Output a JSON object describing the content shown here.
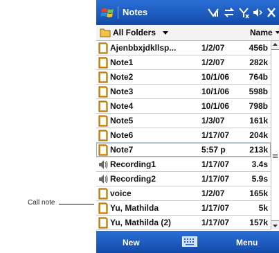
{
  "callout": {
    "label": "Call note"
  },
  "window": {
    "title": "Notes"
  },
  "status_icons": [
    "signal-icon",
    "sync-icon",
    "no-signal-icon",
    "volume-icon",
    "close-icon"
  ],
  "header": {
    "folder_label": "All Folders",
    "sort_label": "Name"
  },
  "rows": [
    {
      "type": "note",
      "name": "Ajenbbxjdkllsp...",
      "date": "1/2/07",
      "size": "456b"
    },
    {
      "type": "note",
      "name": "Note1",
      "date": "1/2/07",
      "size": "282k"
    },
    {
      "type": "note",
      "name": "Note2",
      "date": "10/1/06",
      "size": "764b"
    },
    {
      "type": "note",
      "name": "Note3",
      "date": "10/1/06",
      "size": "598b"
    },
    {
      "type": "note",
      "name": "Note4",
      "date": "10/1/06",
      "size": "798b"
    },
    {
      "type": "note",
      "name": "Note5",
      "date": "1/3/07",
      "size": "161k"
    },
    {
      "type": "note",
      "name": "Note6",
      "date": "1/17/07",
      "size": "204k"
    },
    {
      "type": "note",
      "name": "Note7",
      "date": "5:57 p",
      "size": "213k",
      "selected": true
    },
    {
      "type": "recording",
      "name": "Recording1",
      "date": "1/17/07",
      "size": "3.4s"
    },
    {
      "type": "recording",
      "name": "Recording2",
      "date": "1/17/07",
      "size": "5.9s"
    },
    {
      "type": "note",
      "name": "voice",
      "date": "1/2/07",
      "size": "165k"
    },
    {
      "type": "note",
      "name": "Yu, Mathilda",
      "date": "1/17/07",
      "size": "5k"
    },
    {
      "type": "note",
      "name": "Yu, Mathilda (2)",
      "date": "1/17/07",
      "size": "157k"
    }
  ],
  "menubar": {
    "left": "New",
    "right": "Menu"
  },
  "colors": {
    "titlebar": "#1c5cc4",
    "note_icon": "#f0a020",
    "selection_border": "#9aa7bd"
  }
}
